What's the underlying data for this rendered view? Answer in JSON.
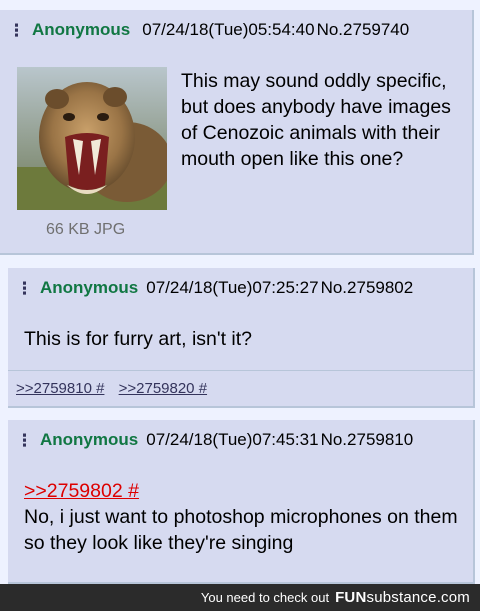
{
  "op": {
    "name": "Anonymous",
    "datetime": "07/24/18(Tue)05:54:40",
    "number": "No.2759740",
    "text": "This may sound oddly specific, but does anybody have images of Cenozoic animals with their mouth open like this one?",
    "file_info": "66 KB JPG"
  },
  "reply1": {
    "name": "Anonymous",
    "datetime": "07/24/18(Tue)07:25:27",
    "number": "No.2759802",
    "text": "This is for furry art, isn't it?",
    "backlinks": [
      ">>2759810 #",
      ">>2759820 #"
    ]
  },
  "reply2": {
    "name": "Anonymous",
    "datetime": "07/24/18(Tue)07:45:31",
    "number": "No.2759810",
    "quote": ">>2759802 #",
    "text": "No, i just want to photoshop microphones on them so they look like they're singing"
  },
  "banner": {
    "text": "You need to check out",
    "brand_prefix": "FUN",
    "brand_suffix": "substance",
    "brand_domain": ".com"
  },
  "colors": {
    "post_bg": "#d6daf0",
    "page_bg": "#eef2ff",
    "name": "#117743",
    "quote": "#dd0000",
    "link": "#34345c"
  }
}
